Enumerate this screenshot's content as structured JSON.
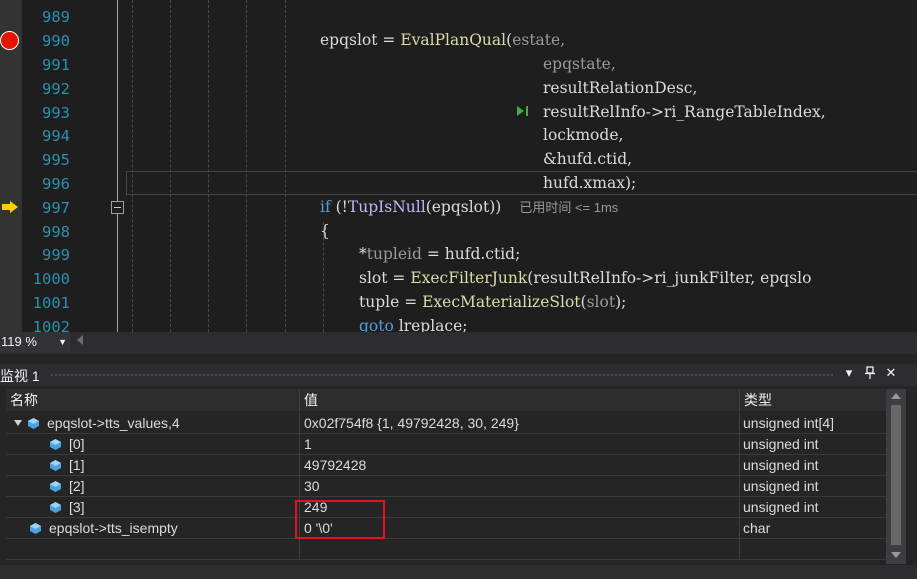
{
  "editor": {
    "line_numbers": [
      "989",
      "990",
      "991",
      "992",
      "993",
      "994",
      "995",
      "996",
      "997",
      "998",
      "999",
      "1000",
      "1001",
      "1002"
    ],
    "breakpoint_line": "990",
    "current_instruction_line": "997",
    "lines": {
      "l990": {
        "var": "epqslot",
        "op": " = ",
        "fn": "EvalPlanQual",
        "open": "(",
        "arg": "estate",
        "tail": ","
      },
      "l991": {
        "arg": "epqstate",
        "tail": ","
      },
      "l992": {
        "text": "resultRelationDesc,"
      },
      "l993": {
        "text": "resultRelInfo->ri_RangeTableIndex,"
      },
      "l994": {
        "text": "lockmode,"
      },
      "l995": {
        "text": "&hufd.ctid,"
      },
      "l996": {
        "text": "hufd.xmax);"
      },
      "l997": {
        "kw": "if",
        "pre": " (!",
        "mac": "TupIsNull",
        "post": "(epqslot))",
        "perf_tip": "已用时间 <= 1ms"
      },
      "l998": {
        "text": "{"
      },
      "l999": {
        "pre": "*",
        "pm": "tupleid",
        "post": " = hufd.ctid;"
      },
      "l1000": {
        "pre": "slot = ",
        "fn": "ExecFilterJunk",
        "post": "(resultRelInfo->ri_junkFilter, epqslo"
      },
      "l1001": {
        "pre": "tuple = ",
        "fn": "ExecMaterializeSlot",
        "open": "(",
        "pm": "slot",
        "post": ");"
      },
      "l1002": {
        "kw": "goto",
        "post": " lreplace;"
      }
    }
  },
  "zoom": {
    "level": "119 %"
  },
  "watch": {
    "title": "监视 1",
    "columns": {
      "name": "名称",
      "value": "值",
      "type": "类型"
    },
    "rows": [
      {
        "name": "epqslot->tts_values,4",
        "value": "0x02f754f8 {1, 49792428, 30, 249}",
        "type": "unsigned int[4]",
        "expanded": true,
        "depth": 0
      },
      {
        "name": "[0]",
        "value": "1",
        "type": "unsigned int",
        "depth": 1
      },
      {
        "name": "[1]",
        "value": "49792428",
        "type": "unsigned int",
        "depth": 1
      },
      {
        "name": "[2]",
        "value": "30",
        "type": "unsigned int",
        "depth": 1
      },
      {
        "name": "[3]",
        "value": "249",
        "type": "unsigned int",
        "depth": 1
      },
      {
        "name": "epqslot->tts_isempty",
        "value": "0 '\\0'",
        "type": "char",
        "depth": 0
      }
    ],
    "buttons": {
      "dropdown": "▾",
      "pin": "📌",
      "close": "✕"
    }
  },
  "colors": {
    "breakpoint": "#e51400",
    "instruction_pointer": "#ffcc00",
    "line_number": "#2b91af",
    "function": "#dcdcaa",
    "keyword": "#569cd6",
    "macro": "#beb7ff",
    "highlight_box": "#e81123",
    "watch_icon": "#4aa3df"
  },
  "icons": {
    "breakpoint": "breakpoint-icon",
    "instruction_pointer": "instruction-pointer-icon",
    "run_to_click": "run-to-click-icon",
    "variable": "variable-cube-icon"
  }
}
